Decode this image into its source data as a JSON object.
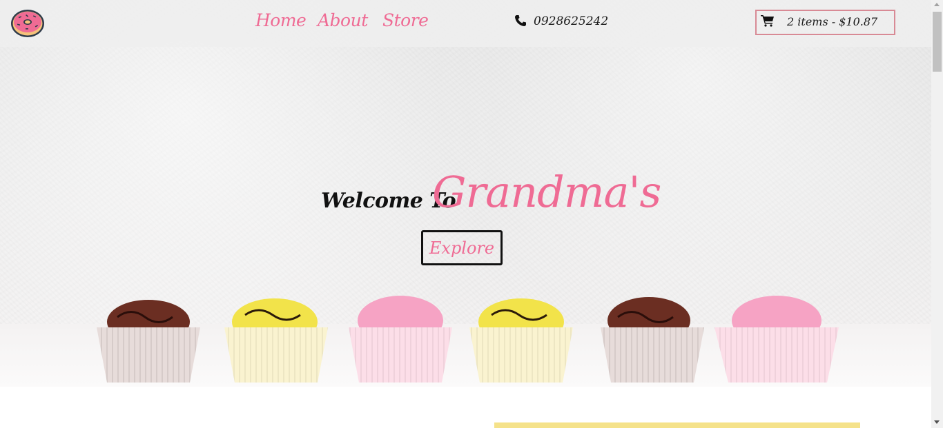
{
  "nav": {
    "links": [
      {
        "label": "Home"
      },
      {
        "label": "About"
      },
      {
        "label": "Store"
      }
    ],
    "phone": "0928625242",
    "cart": {
      "label": "2 items - $10.87"
    }
  },
  "hero": {
    "welcome_text": "Welcome To",
    "brand_name": "Grandma's",
    "explore_label": "Explore"
  },
  "colors": {
    "accent_pink": "#ef6b94",
    "cart_border": "#d88a95",
    "nav_bg": "#eeeeee",
    "highlight_yellow": "#f5e28a",
    "text_dark": "#111111"
  },
  "icons": {
    "logo": "donut-icon",
    "phone": "phone-icon",
    "cart": "shopping-cart-icon"
  }
}
